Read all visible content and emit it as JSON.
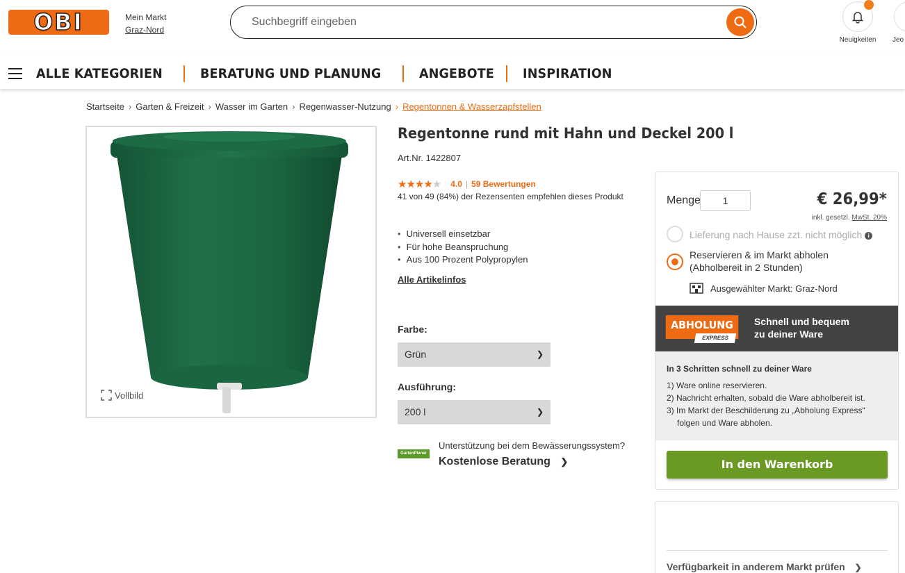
{
  "header": {
    "logo_text": "OBI",
    "market_label": "Mein Markt",
    "market_name": "Graz-Nord",
    "search_placeholder": "Suchbegriff eingeben",
    "notifications_label": "Neuigkeiten",
    "user_label": "Jeo"
  },
  "nav": {
    "items": [
      "ALLE KATEGORIEN",
      "BERATUNG UND PLANUNG",
      "ANGEBOTE",
      "INSPIRATION"
    ]
  },
  "breadcrumb": {
    "items": [
      "Startseite",
      "Garten & Freizeit",
      "Wasser im Garten",
      "Regenwasser-Nutzung"
    ],
    "current": "Regentonnen & Wasserzapfstellen"
  },
  "product": {
    "title": "Regentonne rund mit Hahn und Deckel 200 l",
    "art_nr": "Art.Nr. 1422807",
    "rating": {
      "value": "4.0",
      "count_text": "59 Bewertungen",
      "stars": 4,
      "max": 5
    },
    "recommend_text": "41 von 49 (84%) der Rezensenten empfehlen dieses Produkt",
    "features": [
      "Universell einsetzbar",
      "Für hohe Beanspruchung",
      "Aus 100 Prozent Polypropylen"
    ],
    "all_info_link": "Alle Artikelinfos",
    "fullscreen_label": "Vollbild",
    "farbe_label": "Farbe:",
    "farbe_value": "Grün",
    "ausfuehrung_label": "Ausführung:",
    "ausfuehrung_value": "200 l",
    "support_question": "Unterstützung bei dem Bewässerungssystem?",
    "support_link": "Kostenlose Beratung",
    "garten_logo_text": "GartenPlaner",
    "barrel_color": "#1e6b45"
  },
  "buybox": {
    "menge_label": "Menge",
    "menge_value": "1",
    "price": "€ 26,99*",
    "tax_prefix": "inkl. gesetzl.",
    "tax_link": "MwSt. 20%",
    "delivery_option": "Lieferung nach Hause zzt. nicht möglich",
    "pickup_line1": "Reservieren & im Markt abholen",
    "pickup_line2": "(Abholbereit in 2 Stunden)",
    "selected_market": "Ausgewählter Markt: Graz-Nord",
    "express_badge": "ABHOLUNG",
    "express_sub": "EXPRESS",
    "express_line1": "Schnell und bequem",
    "express_line2": "zu deiner Ware",
    "steps_title": "In 3 Schritten schnell zu deiner Ware",
    "steps": [
      "1) Ware online reservieren.",
      "2) Nachricht erhalten, sobald die Ware abholbereit ist.",
      "3) Im Markt der Beschilderung zu „Abholung Express“",
      "folgen und Ware abholen."
    ],
    "cart_button": "In den Warenkorb",
    "accent": "#ee6b13",
    "cart_color": "#6a9a23"
  },
  "availability": {
    "link": "Verfügbarkeit in anderem Markt prüfen"
  }
}
